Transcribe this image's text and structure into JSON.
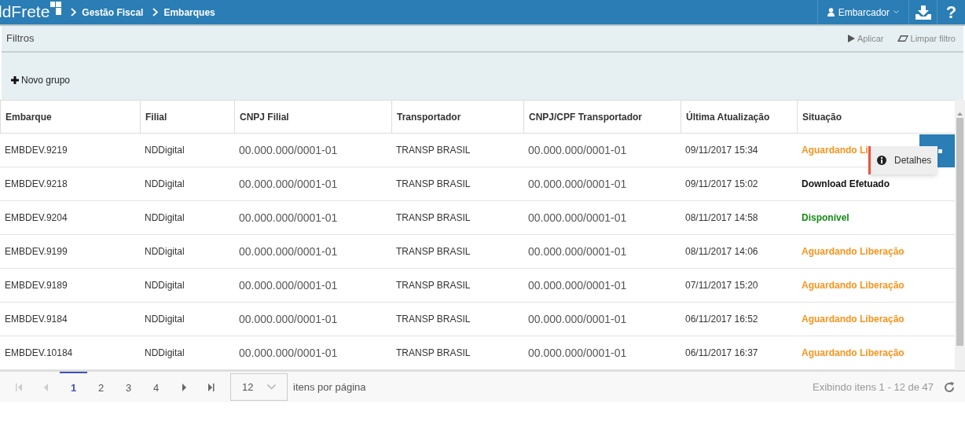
{
  "header": {
    "logo": "ldFrete",
    "breadcrumbs": [
      "Gestão Fiscal",
      "Embarques"
    ],
    "user": "Embarcador",
    "help": "?"
  },
  "filters": {
    "title": "Filtros",
    "actions": [
      "Aplicar",
      "Limpar filtro"
    ],
    "new_group": "Novo grupo"
  },
  "table": {
    "columns": [
      "Embarque",
      "Filial",
      "CNPJ Filial",
      "Transportador",
      "CNPJ/CPF Transportador",
      "Última Atualização",
      "Situação"
    ],
    "rows": [
      {
        "cells": [
          "EMBDEV.9219",
          "NDDigital",
          "00.000.000/0001-01",
          "TRANSP BRASIL",
          "00.000.000/0001-01",
          "09/11/2017 15:34",
          "Aguardando Li"
        ],
        "color": "#f7941d",
        "menu_open": true
      },
      {
        "cells": [
          "EMBDEV.9218",
          "NDDigital",
          "00.000.000/0001-01",
          "TRANSP BRASIL",
          "00.000.000/0001-01",
          "09/11/2017 15:02",
          "Download Efetuado"
        ],
        "color": "#111111",
        "menu_open": false
      },
      {
        "cells": [
          "EMBDEV.9204",
          "NDDigital",
          "00.000.000/0001-01",
          "TRANSP BRASIL",
          "00.000.000/0001-01",
          "08/11/2017 14:58",
          "Disponível"
        ],
        "color": "#168a16",
        "menu_open": false
      },
      {
        "cells": [
          "EMBDEV.9199",
          "NDDigital",
          "00.000.000/0001-01",
          "TRANSP BRASIL",
          "00.000.000/0001-01",
          "08/11/2017 14:06",
          "Aguardando Liberação"
        ],
        "color": "#f7941d",
        "menu_open": false
      },
      {
        "cells": [
          "EMBDEV.9189",
          "NDDigital",
          "00.000.000/0001-01",
          "TRANSP BRASIL",
          "00.000.000/0001-01",
          "07/11/2017 15:20",
          "Aguardando Liberação"
        ],
        "color": "#f7941d",
        "menu_open": false
      },
      {
        "cells": [
          "EMBDEV.9184",
          "NDDigital",
          "00.000.000/0001-01",
          "TRANSP BRASIL",
          "00.000.000/0001-01",
          "06/11/2017 16:52",
          "Aguardando Liberação"
        ],
        "color": "#f7941d",
        "menu_open": false
      },
      {
        "cells": [
          "EMBDEV.10184",
          "NDDigital",
          "00.000.000/0001-01",
          "TRANSP BRASIL",
          "00.000.000/0001-01",
          "06/11/2017 16:37",
          "Aguardando Liberação"
        ],
        "color": "#f7941d",
        "menu_open": false
      }
    ]
  },
  "row_menu": {
    "items": [
      "Detalhes"
    ]
  },
  "pager": {
    "pages": [
      {
        "label": "1",
        "selected": true
      },
      {
        "label": "2",
        "selected": false
      },
      {
        "label": "3",
        "selected": false
      },
      {
        "label": "4",
        "selected": false
      }
    ],
    "page_size": "12",
    "page_size_label": "itens por página",
    "summary": "Exibindo itens 1 - 12 de 47"
  }
}
